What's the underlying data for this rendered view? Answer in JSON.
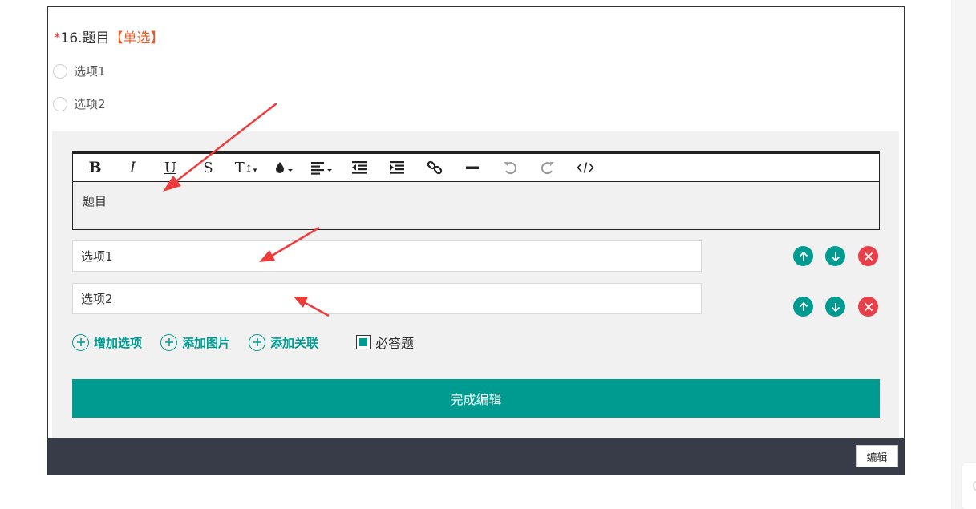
{
  "question": {
    "required_mark": "*",
    "number_title": "16.题目",
    "type_tag": "【单选】",
    "options": [
      {
        "label": "选项1"
      },
      {
        "label": "选项2"
      }
    ]
  },
  "editor": {
    "toolbar": [
      {
        "name": "bold",
        "glyph": "B"
      },
      {
        "name": "italic",
        "glyph": "I"
      },
      {
        "name": "underline",
        "glyph": "U"
      },
      {
        "name": "strikethrough",
        "glyph": "S"
      },
      {
        "name": "font-size",
        "glyph": "T↕"
      },
      {
        "name": "font-color",
        "glyph": "drop"
      },
      {
        "name": "align",
        "glyph": "align"
      },
      {
        "name": "outdent",
        "glyph": "outdent"
      },
      {
        "name": "indent",
        "glyph": "indent"
      },
      {
        "name": "link",
        "glyph": "link"
      },
      {
        "name": "horizontal-rule",
        "glyph": "hr"
      },
      {
        "name": "undo",
        "glyph": "undo"
      },
      {
        "name": "redo",
        "glyph": "redo"
      },
      {
        "name": "source-code",
        "glyph": "</>"
      }
    ],
    "body_text": "题目",
    "option_inputs": [
      {
        "value": "选项1"
      },
      {
        "value": "选项2"
      }
    ],
    "actions": {
      "add_option": "增加选项",
      "add_image": "添加图片",
      "add_relation": "添加关联",
      "required_label": "必答题"
    },
    "done_label": "完成编辑"
  },
  "footer": {
    "edit_label": "编辑"
  },
  "colors": {
    "accent": "#009b90",
    "delete": "#e8404a",
    "type_tag": "#ee5a24",
    "footer": "#383c48",
    "annotation_arrow": "#ee3b3b"
  }
}
